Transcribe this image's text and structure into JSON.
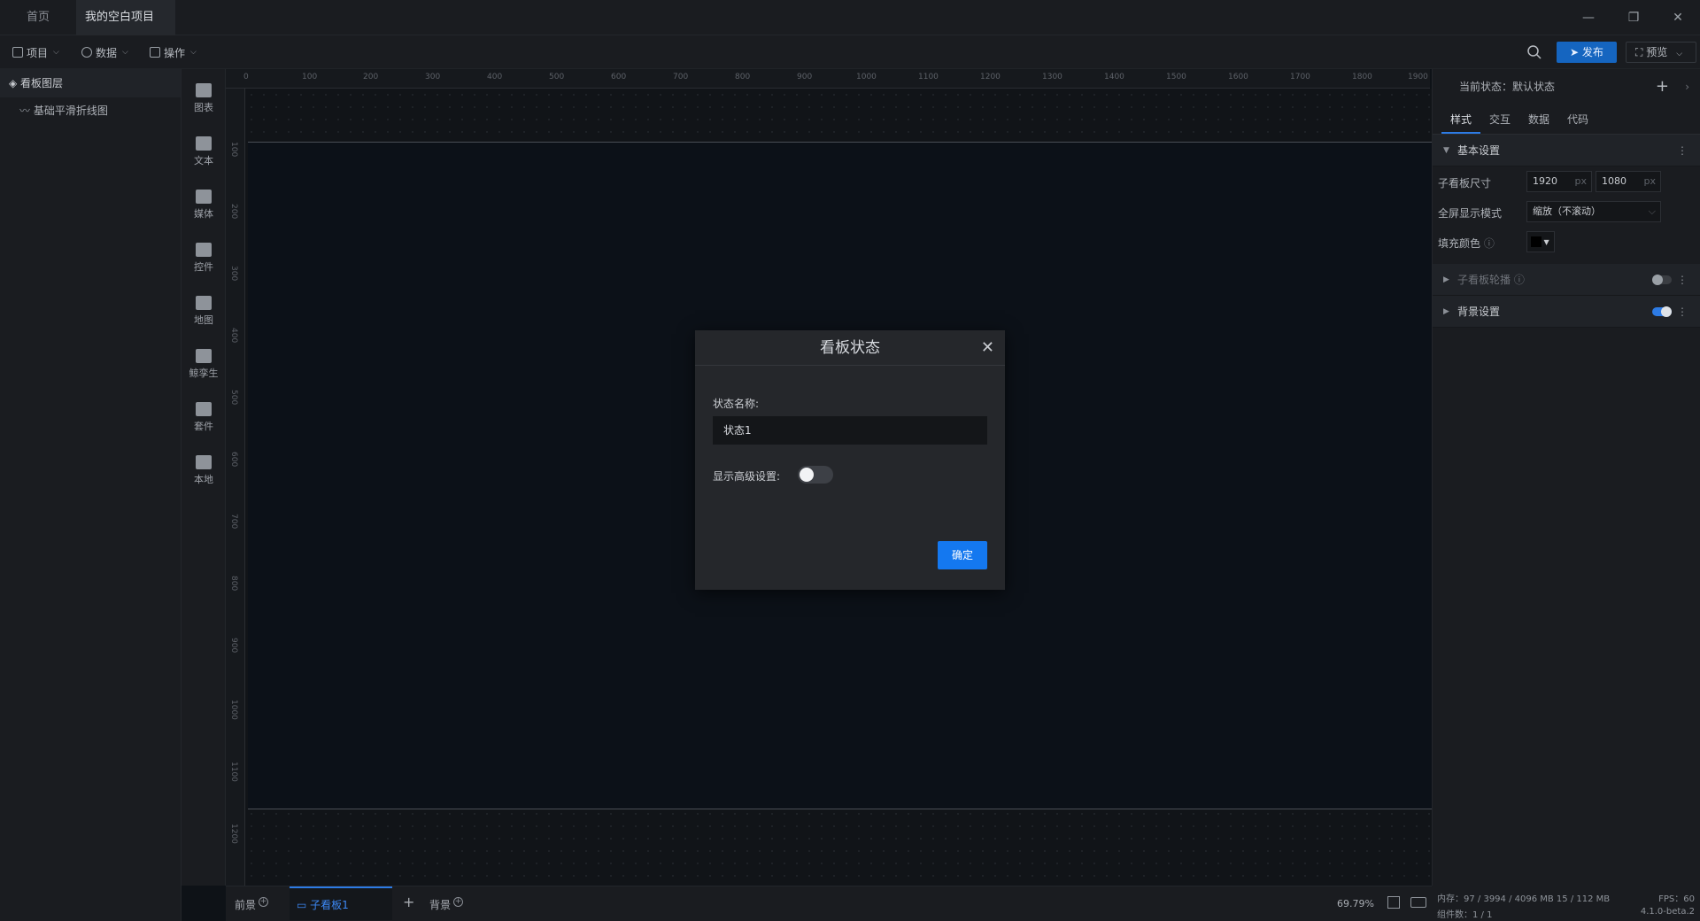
{
  "titlebar": {
    "tabs": [
      {
        "label": "首页"
      },
      {
        "label": "我的空白项目"
      }
    ]
  },
  "toolbar": {
    "menus": [
      "项目",
      "数据",
      "操作"
    ],
    "publish_label": "发布",
    "preview_label": "预览"
  },
  "layers": {
    "title": "看板图层",
    "items": [
      "基础平滑折线图"
    ]
  },
  "components": [
    "图表",
    "文本",
    "媒体",
    "控件",
    "地图",
    "鲸孪生",
    "套件",
    "本地"
  ],
  "ruler": {
    "top_labels": [
      "0",
      "100",
      "200",
      "300",
      "400",
      "500",
      "600",
      "700",
      "800",
      "900",
      "1000",
      "1100",
      "1200",
      "1300",
      "1400",
      "1500",
      "1600",
      "1700",
      "1800",
      "1900"
    ],
    "left_labels": [
      "100",
      "200",
      "300",
      "400",
      "500",
      "600",
      "700",
      "800",
      "900",
      "1000",
      "1100",
      "1200"
    ]
  },
  "bottombar": {
    "tabs": [
      "前景",
      "子看板1",
      "背景"
    ],
    "zoom": "69.79%"
  },
  "rightpanel": {
    "current_state": "当前状态：默认状态",
    "tabs": [
      "样式",
      "交互",
      "数据",
      "代码"
    ],
    "basic_section": "基本设置",
    "size_label": "子看板尺寸",
    "width": "1920",
    "height": "1080",
    "unit": "px",
    "fullscreen_label": "全屏显示模式",
    "fullscreen_value": "缩放（不滚动）",
    "fill_label": "填充颜色",
    "carousel_section": "子看板轮播",
    "bg_section": "背景设置"
  },
  "status": {
    "memory": "内存：97 / 3994 / 4096 MB  15 / 112 MB",
    "fps": "FPS：60",
    "components": "组件数：1 / 1",
    "version": "4.1.0-beta.2"
  },
  "modal": {
    "title": "看板状态",
    "name_label": "状态名称:",
    "name_value": "状态1",
    "advanced_label": "显示高级设置:",
    "ok_label": "确定"
  },
  "colors": {
    "accent": "#1478f0",
    "publish_bg": "#1565c0",
    "unsaved_dot": "#e5a443"
  }
}
